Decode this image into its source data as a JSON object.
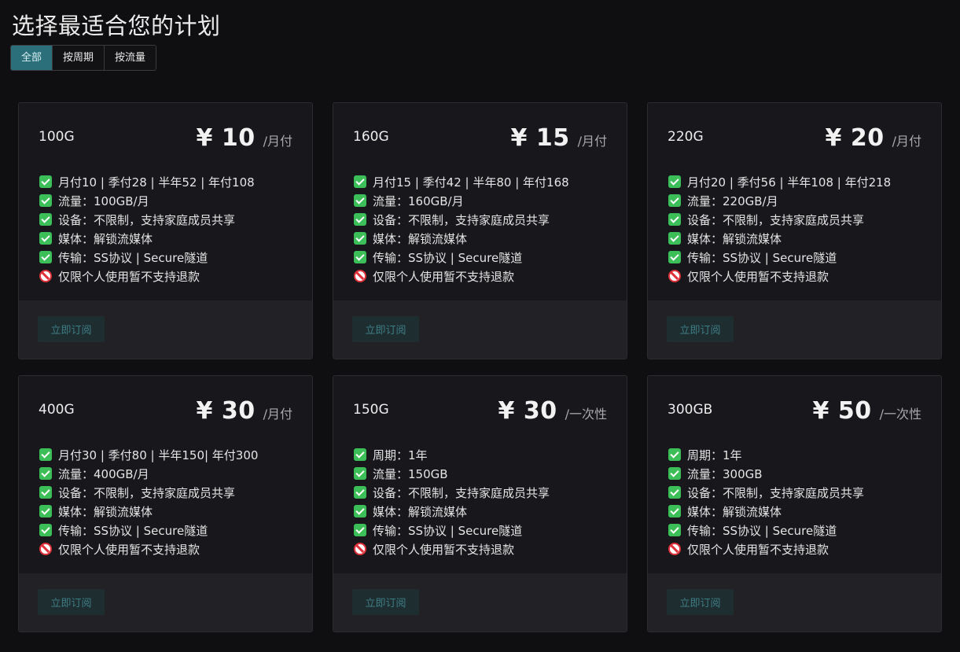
{
  "page_title": "选择最适合您的计划",
  "tabs": [
    {
      "label": "全部",
      "active": true
    },
    {
      "label": "按周期",
      "active": false
    },
    {
      "label": "按流量",
      "active": false
    }
  ],
  "colors": {
    "accent": "#2a6f7a",
    "check": "#3cbf58",
    "prohibit": "#e0313b",
    "background": "#0f0f11",
    "card": "#18181c"
  },
  "plans": [
    {
      "name": "100G",
      "price": "¥ 10",
      "unit": "/月付",
      "features": [
        {
          "icon": "check-icon",
          "text": "月付10 | 季付28 | 半年52 | 年付108"
        },
        {
          "icon": "check-icon",
          "text": "流量：100GB/月"
        },
        {
          "icon": "check-icon",
          "text": "设备：不限制，支持家庭成员共享"
        },
        {
          "icon": "check-icon",
          "text": "媒体：解锁流媒体"
        },
        {
          "icon": "check-icon",
          "text": "传输：SS协议 | Secure隧道"
        },
        {
          "icon": "prohibited-icon",
          "text": "仅限个人使用暂不支持退款"
        }
      ],
      "button": "立即订阅"
    },
    {
      "name": "160G",
      "price": "¥ 15",
      "unit": "/月付",
      "features": [
        {
          "icon": "check-icon",
          "text": "月付15 | 季付42 | 半年80 | 年付168"
        },
        {
          "icon": "check-icon",
          "text": "流量：160GB/月"
        },
        {
          "icon": "check-icon",
          "text": "设备：不限制，支持家庭成员共享"
        },
        {
          "icon": "check-icon",
          "text": "媒体：解锁流媒体"
        },
        {
          "icon": "check-icon",
          "text": "传输：SS协议 | Secure隧道"
        },
        {
          "icon": "prohibited-icon",
          "text": "仅限个人使用暂不支持退款"
        }
      ],
      "button": "立即订阅"
    },
    {
      "name": "220G",
      "price": "¥ 20",
      "unit": "/月付",
      "features": [
        {
          "icon": "check-icon",
          "text": "月付20 | 季付56 | 半年108 | 年付218"
        },
        {
          "icon": "check-icon",
          "text": "流量：220GB/月"
        },
        {
          "icon": "check-icon",
          "text": "设备：不限制，支持家庭成员共享"
        },
        {
          "icon": "check-icon",
          "text": "媒体：解锁流媒体"
        },
        {
          "icon": "check-icon",
          "text": "传输：SS协议 | Secure隧道"
        },
        {
          "icon": "prohibited-icon",
          "text": "仅限个人使用暂不支持退款"
        }
      ],
      "button": "立即订阅"
    },
    {
      "name": "400G",
      "price": "¥ 30",
      "unit": "/月付",
      "features": [
        {
          "icon": "check-icon",
          "text": "月付30 | 季付80 | 半年150| 年付300"
        },
        {
          "icon": "check-icon",
          "text": "流量：400GB/月"
        },
        {
          "icon": "check-icon",
          "text": "设备：不限制，支持家庭成员共享"
        },
        {
          "icon": "check-icon",
          "text": "媒体：解锁流媒体"
        },
        {
          "icon": "check-icon",
          "text": "传输：SS协议 | Secure隧道"
        },
        {
          "icon": "prohibited-icon",
          "text": "仅限个人使用暂不支持退款"
        }
      ],
      "button": "立即订阅"
    },
    {
      "name": "150G",
      "price": "¥ 30",
      "unit": "/一次性",
      "features": [
        {
          "icon": "check-icon",
          "text": "周期：1年"
        },
        {
          "icon": "check-icon",
          "text": "流量：150GB"
        },
        {
          "icon": "check-icon",
          "text": "设备：不限制，支持家庭成员共享"
        },
        {
          "icon": "check-icon",
          "text": "媒体：解锁流媒体"
        },
        {
          "icon": "check-icon",
          "text": "传输：SS协议 | Secure隧道"
        },
        {
          "icon": "prohibited-icon",
          "text": "仅限个人使用暂不支持退款"
        }
      ],
      "button": "立即订阅"
    },
    {
      "name": "300GB",
      "price": "¥ 50",
      "unit": "/一次性",
      "features": [
        {
          "icon": "check-icon",
          "text": "周期：1年"
        },
        {
          "icon": "check-icon",
          "text": "流量：300GB"
        },
        {
          "icon": "check-icon",
          "text": "设备：不限制，支持家庭成员共享"
        },
        {
          "icon": "check-icon",
          "text": "媒体：解锁流媒体"
        },
        {
          "icon": "check-icon",
          "text": "传输：SS协议 | Secure隧道"
        },
        {
          "icon": "prohibited-icon",
          "text": "仅限个人使用暂不支持退款"
        }
      ],
      "button": "立即订阅"
    }
  ]
}
